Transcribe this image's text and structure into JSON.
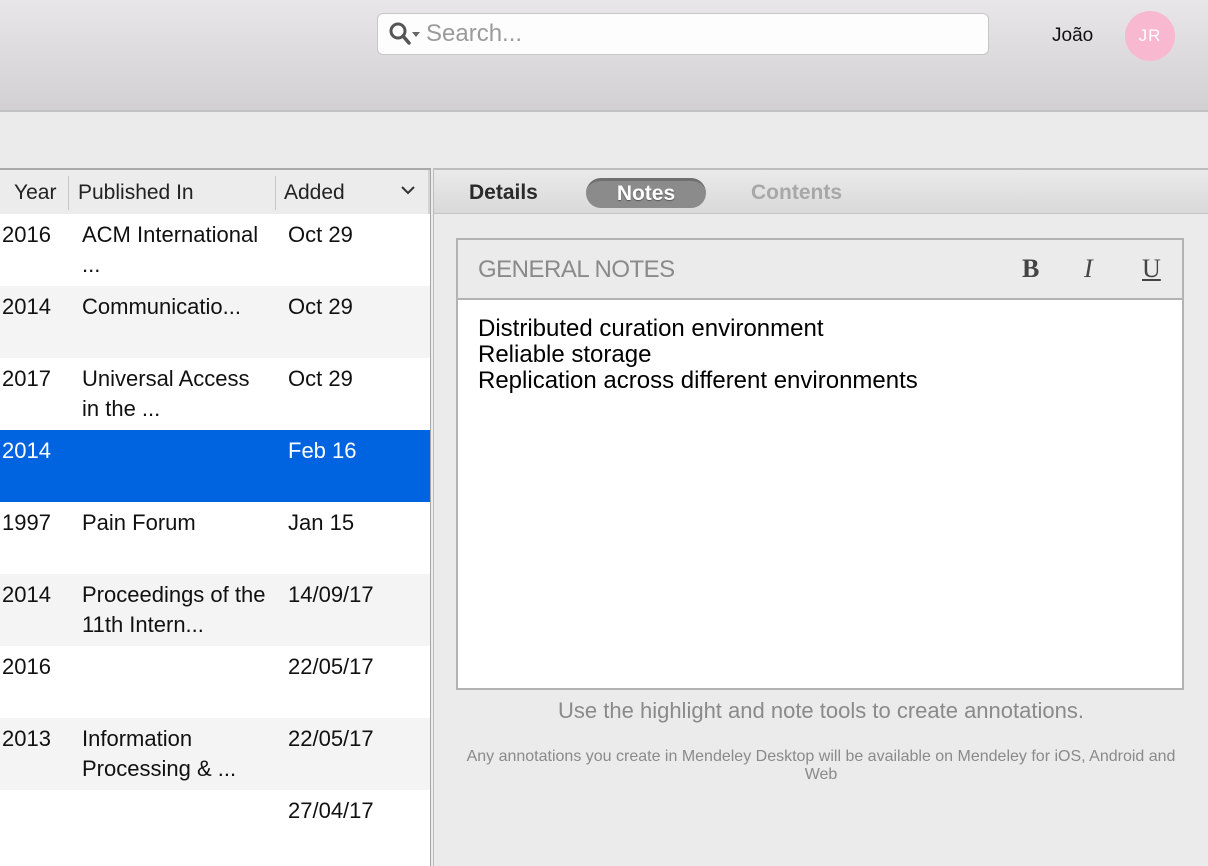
{
  "toolbar": {
    "search": {
      "placeholder": "Search...",
      "value": "",
      "icon": "search-icon"
    },
    "user": {
      "name": "João",
      "initials": "JR",
      "avatar_color": "#f8b8cf"
    }
  },
  "table": {
    "columns": [
      {
        "label": "Year"
      },
      {
        "label": "Published In"
      },
      {
        "label": "Added",
        "sort_icon": "chevron-down-icon"
      }
    ],
    "rows": [
      {
        "year": "2016",
        "published_in": "ACM International ...",
        "added": "Oct 29",
        "selected": false
      },
      {
        "year": "2014",
        "published_in": "Communicatio...",
        "added": "Oct 29",
        "selected": false
      },
      {
        "year": "2017",
        "published_in": "Universal Access in the ...",
        "added": "Oct 29",
        "selected": false
      },
      {
        "year": "2014",
        "published_in": "",
        "added": "Feb 16",
        "selected": true
      },
      {
        "year": "1997",
        "published_in": "Pain Forum",
        "added": "Jan 15",
        "selected": false
      },
      {
        "year": "2014",
        "published_in": "Proceedings of the 11th Intern...",
        "added": "14/09/17",
        "selected": false
      },
      {
        "year": "2016",
        "published_in": "",
        "added": "22/05/17",
        "selected": false
      },
      {
        "year": "2013",
        "published_in": "Information Processing & ...",
        "added": "22/05/17",
        "selected": false
      },
      {
        "year": "",
        "published_in": "",
        "added": "27/04/17",
        "selected": false
      }
    ],
    "selected_color": "#0064e1"
  },
  "details_panel": {
    "tabs": [
      {
        "label": "Details",
        "active": false
      },
      {
        "label": "Notes",
        "active": true
      },
      {
        "label": "Contents",
        "active": false,
        "disabled": true
      }
    ],
    "notes": {
      "title": "GENERAL NOTES",
      "format_buttons": {
        "bold": "B",
        "italic": "I",
        "underline": "U"
      },
      "lines": [
        "Distributed curation environment",
        "Reliable storage",
        "Replication across different environments"
      ]
    },
    "hint": "Use the highlight and note tools to create annotations.",
    "sync_info": "Any annotations you create in Mendeley Desktop will be available on Mendeley for iOS, Android and Web"
  }
}
